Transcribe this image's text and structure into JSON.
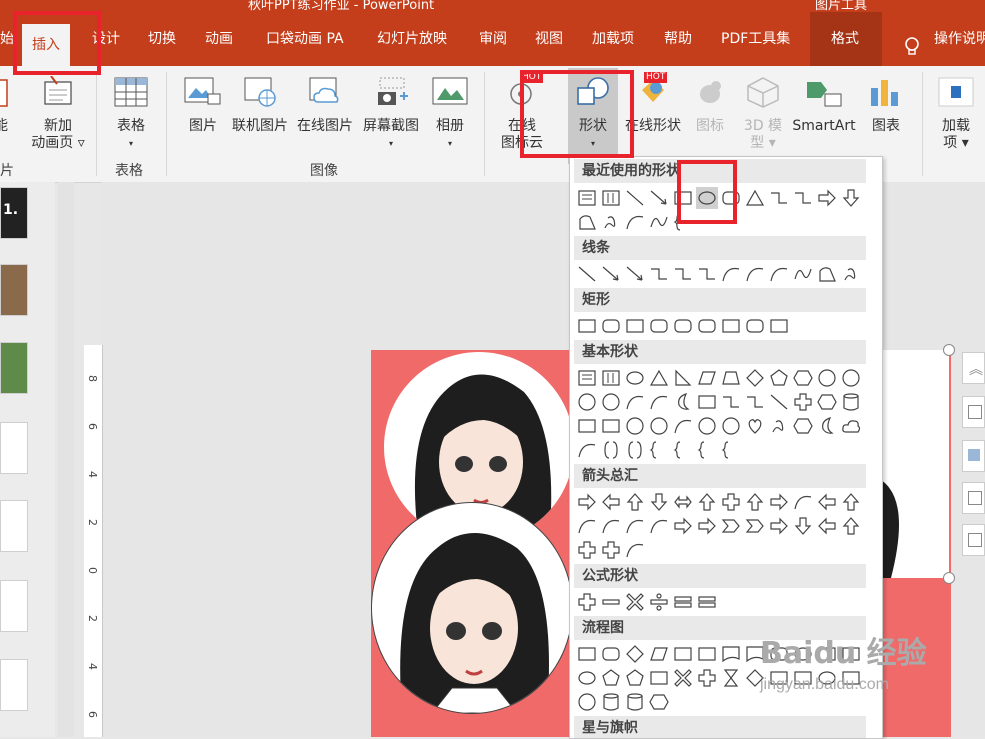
{
  "app": {
    "title": "秋叶PPT练习作业 - PowerPoint",
    "context_tab_group": "图片工具"
  },
  "tabs": [
    {
      "label": "始"
    },
    {
      "label": "插入"
    },
    {
      "label": "设计"
    },
    {
      "label": "切换"
    },
    {
      "label": "动画"
    },
    {
      "label": "口袋动画 PA"
    },
    {
      "label": "幻灯片放映"
    },
    {
      "label": "审阅"
    },
    {
      "label": "视图"
    },
    {
      "label": "加载项"
    },
    {
      "label": "帮助"
    },
    {
      "label": "PDF工具集"
    },
    {
      "label": "格式"
    }
  ],
  "tell_me": "操作说明",
  "ribbon": {
    "slides_group": {
      "new_anim_line1": "新加",
      "new_anim_line2": "动画页 ▿",
      "label": "片",
      "left_label": "能"
    },
    "table_group": {
      "table": "表格",
      "label": "表格"
    },
    "image_group": {
      "picture": "图片",
      "online_pic_alt": "联机图片",
      "online_pic": "在线图片",
      "screenshot": "屏幕截图",
      "album": "相册",
      "label": "图像"
    },
    "online_cloud": {
      "line1": "在线",
      "line2": "图标云",
      "hot": "HOT"
    },
    "shapes": "形状",
    "online_shapes": {
      "label": "在线形状",
      "hot": "HOT"
    },
    "icons": "图标",
    "models_3d": {
      "line1": "3D 模",
      "line2": "型 ▾"
    },
    "smartart": "SmartArt",
    "chart": "图表",
    "addins": {
      "line1": "加载",
      "line2": "项 ▾"
    }
  },
  "thumbnails": {
    "first_label": "1."
  },
  "ruler": {
    "marks": [
      "8",
      "6",
      "4",
      "2",
      "0",
      "2",
      "4",
      "6"
    ]
  },
  "shapes_menu": {
    "sections": [
      {
        "title": "最近使用的形状"
      },
      {
        "title": "线条"
      },
      {
        "title": "矩形"
      },
      {
        "title": "基本形状"
      },
      {
        "title": "箭头总汇"
      },
      {
        "title": "公式形状"
      },
      {
        "title": "流程图"
      },
      {
        "title": "星与旗帜"
      }
    ],
    "selected_shape": "oval"
  },
  "watermark": {
    "brand": "Baidu 经验",
    "url": "jingyan.baidu.com"
  },
  "colors": {
    "accent": "#c43e1c",
    "highlight_box": "#e8232b",
    "slide_background": "#f06a6a"
  }
}
